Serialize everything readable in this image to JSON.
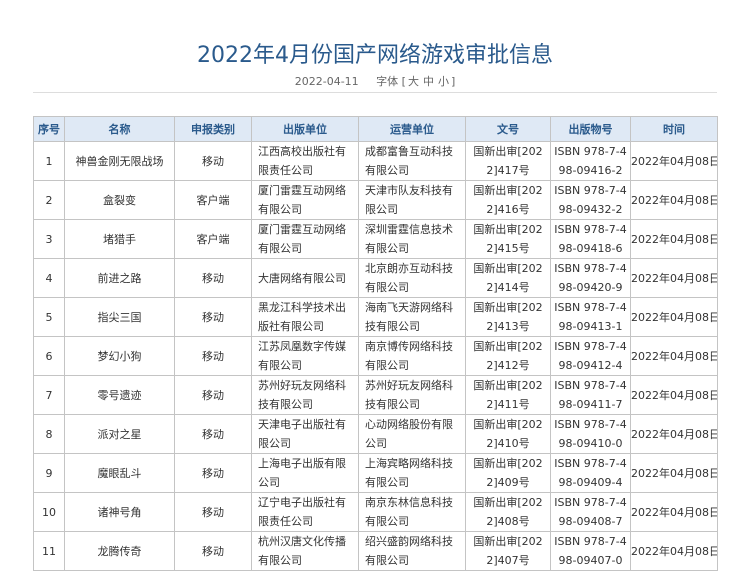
{
  "article": {
    "title": "2022年4月份国产网络游戏审批信息",
    "date": "2022-04-11",
    "font_label": "字体",
    "font_sizes": [
      "大",
      "中",
      "小"
    ]
  },
  "table": {
    "headers": [
      "序号",
      "名称",
      "申报类别",
      "出版单位",
      "运营单位",
      "文号",
      "出版物号",
      "时间"
    ],
    "rows": [
      [
        "1",
        "神兽金刚无限战场",
        "移动",
        "江西高校出版社有限责任公司",
        "成都富鲁互动科技有限公司",
        "国新出审[2022]417号",
        "ISBN 978-7-498-09416-2",
        "2022年04月08日"
      ],
      [
        "2",
        "盒裂变",
        "客户端",
        "厦门雷霆互动网络有限公司",
        "天津市队友科技有限公司",
        "国新出审[2022]416号",
        "ISBN 978-7-498-09432-2",
        "2022年04月08日"
      ],
      [
        "3",
        "堵猎手",
        "客户端",
        "厦门雷霆互动网络有限公司",
        "深圳雷霆信息技术有限公司",
        "国新出审[2022]415号",
        "ISBN 978-7-498-09418-6",
        "2022年04月08日"
      ],
      [
        "4",
        "前进之路",
        "移动",
        "大唐网络有限公司",
        "北京朗亦互动科技有限公司",
        "国新出审[2022]414号",
        "ISBN 978-7-498-09420-9",
        "2022年04月08日"
      ],
      [
        "5",
        "指尖三国",
        "移动",
        "黑龙江科学技术出版社有限公司",
        "海南飞天游网络科技有限公司",
        "国新出审[2022]413号",
        "ISBN 978-7-498-09413-1",
        "2022年04月08日"
      ],
      [
        "6",
        "梦幻小狗",
        "移动",
        "江苏凤凰数字传媒有限公司",
        "南京博传网络科技有限公司",
        "国新出审[2022]412号",
        "ISBN 978-7-498-09412-4",
        "2022年04月08日"
      ],
      [
        "7",
        "零号遗迹",
        "移动",
        "苏州好玩友网络科技有限公司",
        "苏州好玩友网络科技有限公司",
        "国新出审[2022]411号",
        "ISBN 978-7-498-09411-7",
        "2022年04月08日"
      ],
      [
        "8",
        "派对之星",
        "移动",
        "天津电子出版社有限公司",
        "心动网络股份有限公司",
        "国新出审[2022]410号",
        "ISBN 978-7-498-09410-0",
        "2022年04月08日"
      ],
      [
        "9",
        "魔眼乱斗",
        "移动",
        "上海电子出版有限公司",
        "上海宾略网络科技有限公司",
        "国新出审[2022]409号",
        "ISBN 978-7-498-09409-4",
        "2022年04月08日"
      ],
      [
        "10",
        "诸神号角",
        "移动",
        "辽宁电子出版社有限责任公司",
        "南京东林信息科技有限公司",
        "国新出审[2022]408号",
        "ISBN 978-7-498-09408-7",
        "2022年04月08日"
      ],
      [
        "11",
        "龙腾传奇",
        "移动",
        "杭州汉唐文化传播有限公司",
        "绍兴盛韵网络科技有限公司",
        "国新出审[2022]407号",
        "ISBN 978-7-498-09407-0",
        "2022年04月08日"
      ]
    ]
  },
  "colors": {
    "title": "#2a5a8c",
    "header_bg": "#dfe9f5",
    "header_text": "#2a5a8c",
    "border": "#c4c4c4"
  }
}
